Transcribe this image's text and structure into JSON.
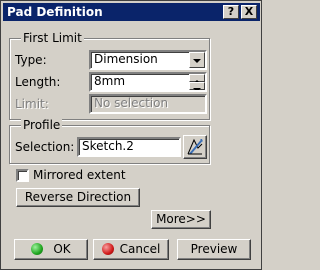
{
  "window": {
    "title": "Pad Definition",
    "help_label": "?",
    "close_label": "X"
  },
  "first_limit": {
    "group_label": "First Limit",
    "type_label": "Type:",
    "type_value": "Dimension",
    "length_label": "Length:",
    "length_value": "8mm",
    "limit_label": "Limit:",
    "limit_value": "No selection"
  },
  "profile": {
    "group_label": "Profile",
    "selection_label": "Selection:",
    "selection_value": "Sketch.2"
  },
  "mirrored_extent": {
    "label": "Mirrored extent",
    "checked": false
  },
  "reverse_direction_label": "Reverse Direction",
  "more_label": "More>>",
  "footer": {
    "ok_label": "OK",
    "cancel_label": "Cancel",
    "preview_label": "Preview"
  },
  "colors": {
    "titlebar": "#0a246a",
    "ok_icon": "#1fa51f",
    "cancel_icon": "#d11a1a"
  }
}
